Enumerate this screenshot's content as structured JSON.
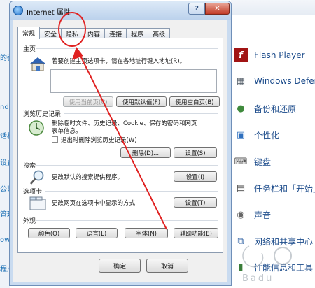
{
  "dialog": {
    "title": "Internet 属性",
    "help_label": "?",
    "tabs": [
      {
        "label": "常规",
        "active": true
      },
      {
        "label": "安全"
      },
      {
        "label": "隐私"
      },
      {
        "label": "内容"
      },
      {
        "label": "连接"
      },
      {
        "label": "程序"
      },
      {
        "label": "高级"
      }
    ],
    "homepage": {
      "section": "主页",
      "description": "若要创建主页选项卡，请在各地址行键入地址(R)。",
      "address_value": "",
      "btn_current": "使用当前页(C)",
      "btn_default": "使用默认值(F)",
      "btn_blank": "使用空白页(B)"
    },
    "history": {
      "section": "浏览历史记录",
      "description_line1": "删除临时文件、历史记录、Cookie、保存的密码和网页",
      "description_line2": "表单信息。",
      "checkbox_label": "退出时删除浏览历史记录(W)",
      "btn_delete": "删除(D)...",
      "btn_settings": "设置(S)"
    },
    "search": {
      "section": "搜索",
      "description": "更改默认的搜索提供程序。",
      "btn_settings": "设置(I)"
    },
    "tabs_section": {
      "section": "选项卡",
      "description": "更改网页在选项卡中显示的方式",
      "btn_settings": "设置(T)"
    },
    "appearance": {
      "section": "外观",
      "btn_colors": "颜色(O)",
      "btn_languages": "语言(L)",
      "btn_fonts": "字体(N)",
      "btn_accessibility": "辅助功能(E)"
    },
    "btn_ok": "确定",
    "btn_cancel": "取消"
  },
  "background": {
    "left_labels": [
      "的强",
      "nd",
      "话框",
      "设置",
      "公司",
      "管理",
      "ow",
      "程序"
    ],
    "items": [
      {
        "label": "Flash Player",
        "icon": "flash-icon"
      },
      {
        "label": "Windows Defen",
        "icon": "defender-icon"
      },
      {
        "label": "备份和还原",
        "icon": "backup-icon"
      },
      {
        "label": "个性化",
        "icon": "personalize-icon"
      },
      {
        "label": "键盘",
        "icon": "keyboard-icon"
      },
      {
        "label": "任务栏和「开始」",
        "icon": "taskbar-icon"
      },
      {
        "label": "声音",
        "icon": "sound-icon"
      },
      {
        "label": "网络和共享中心",
        "icon": "network-icon"
      },
      {
        "label": "性能信息和工具",
        "icon": "performance-icon"
      }
    ]
  },
  "watermark": "Badu"
}
